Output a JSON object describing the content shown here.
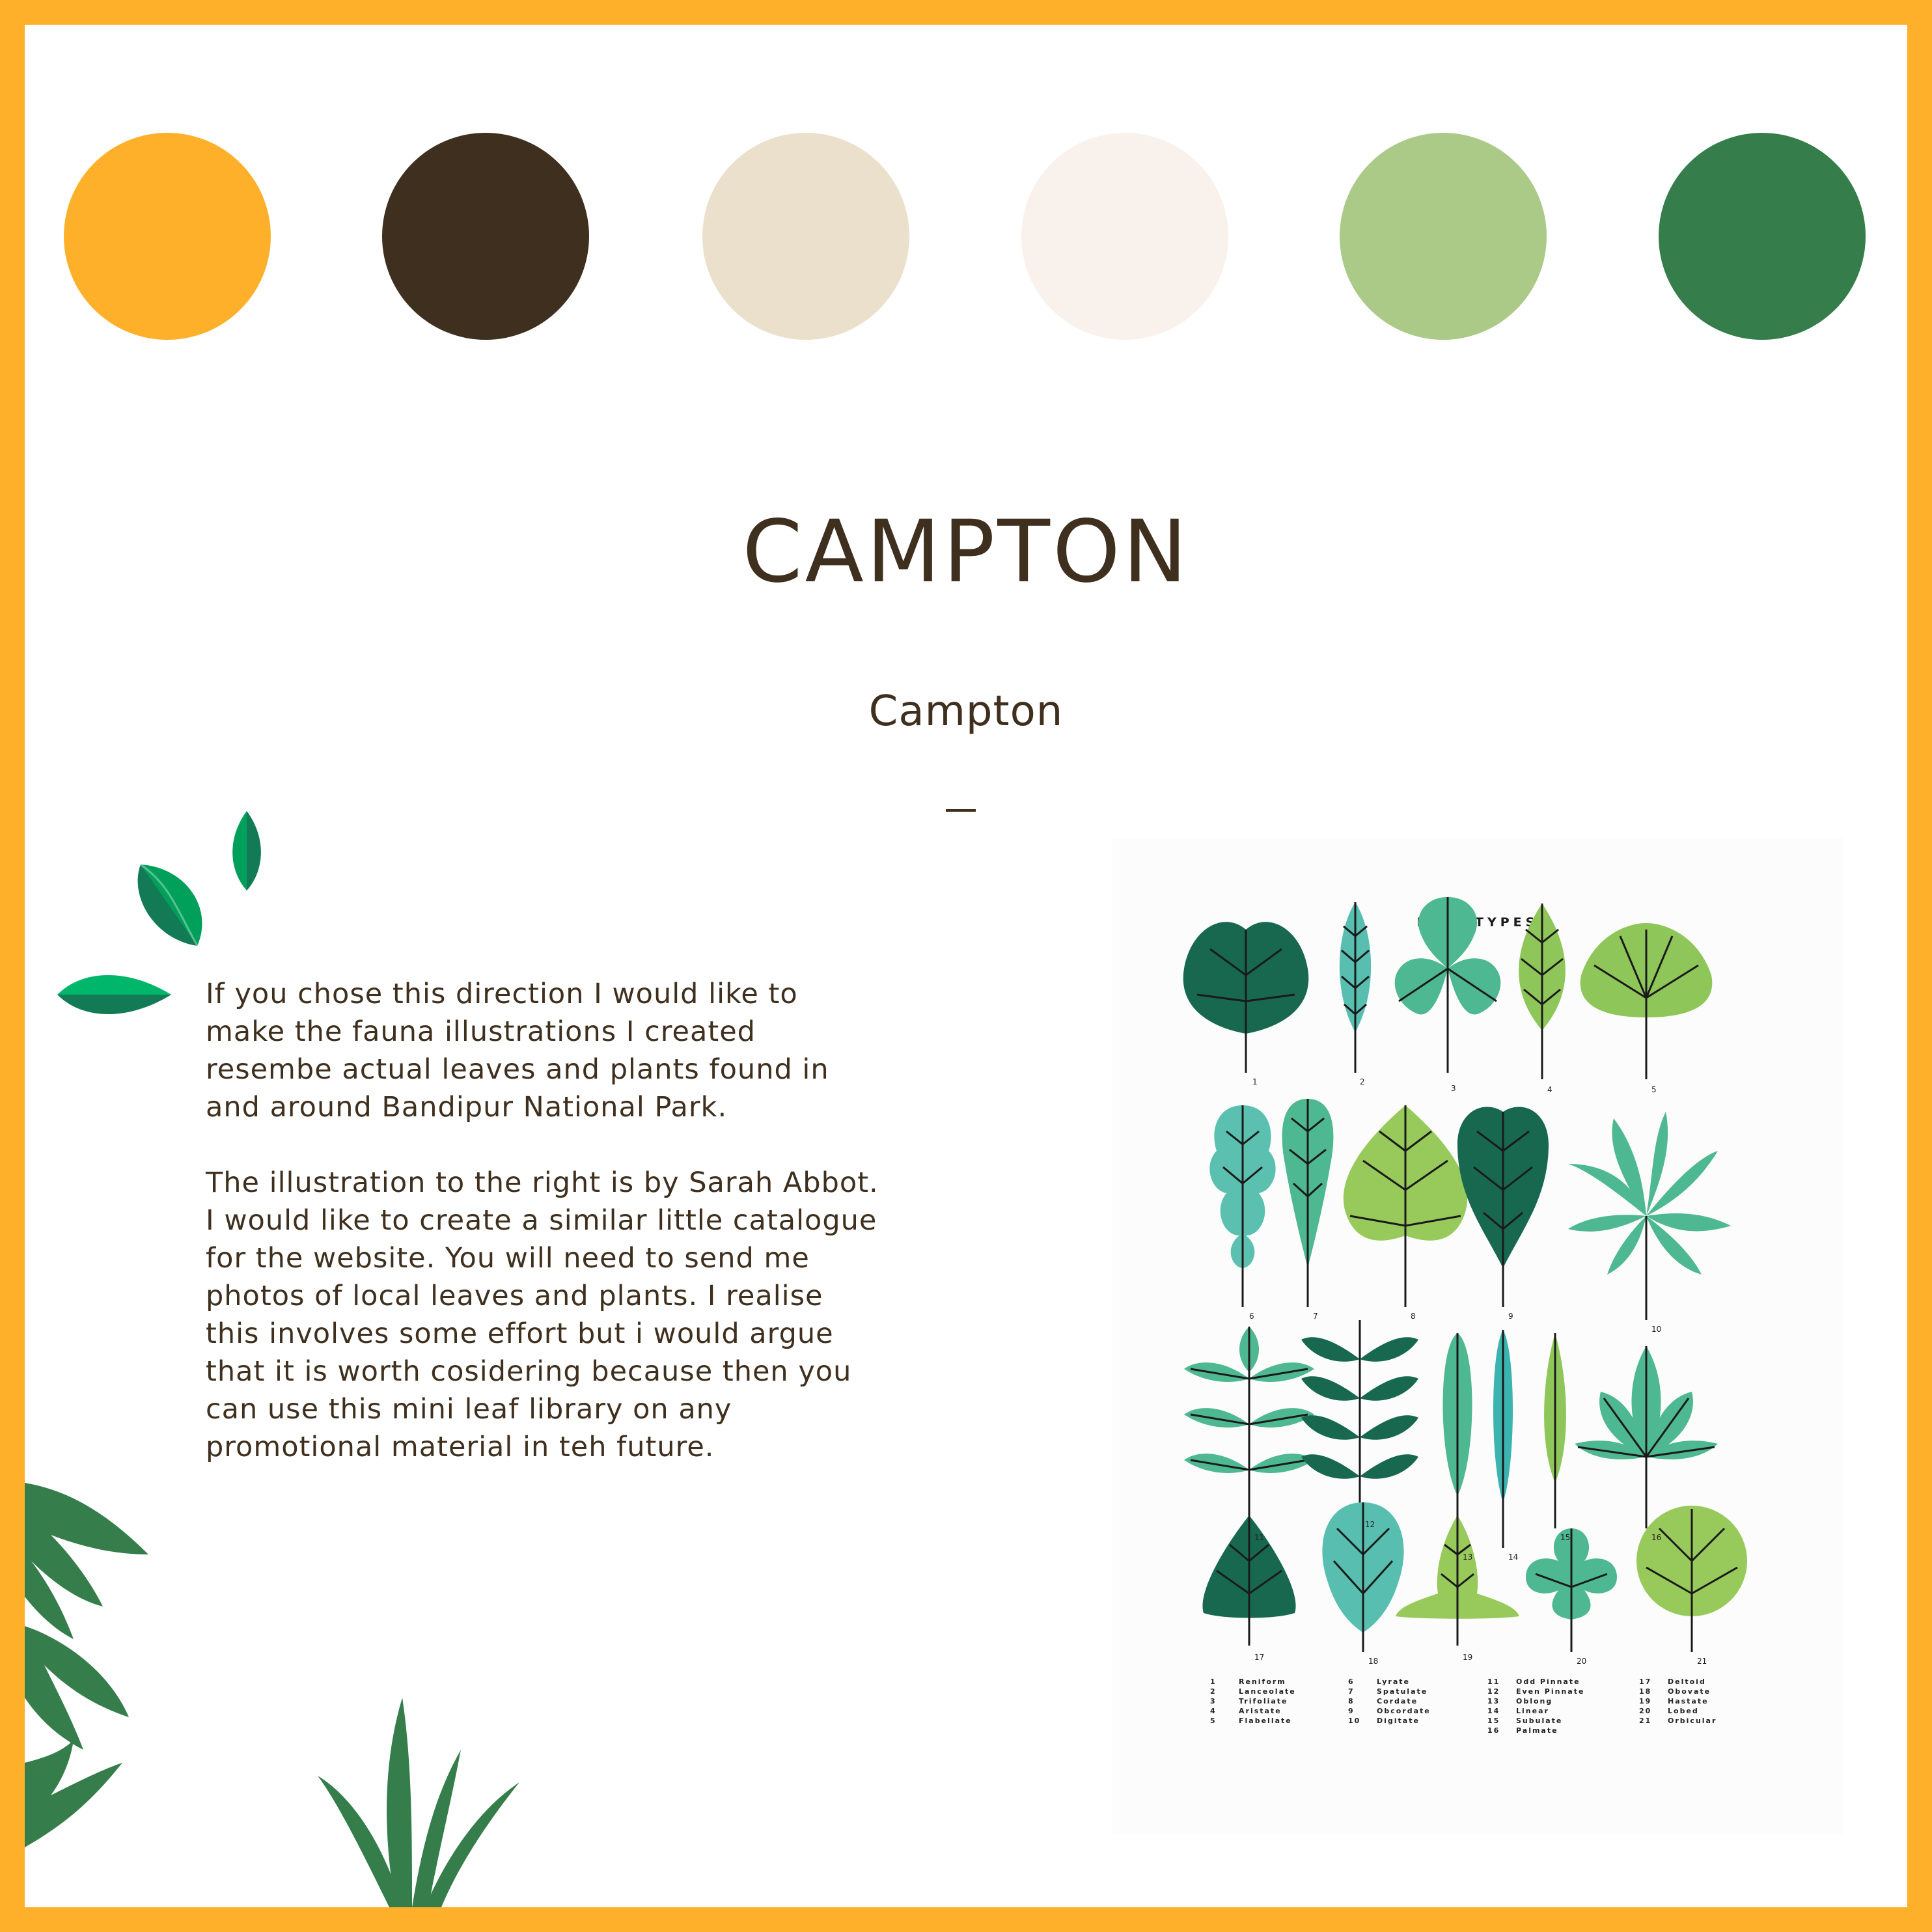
{
  "palette": [
    {
      "name": "orange",
      "hex": "#FFB02B"
    },
    {
      "name": "dark-brown",
      "hex": "#3F2F1E"
    },
    {
      "name": "beige",
      "hex": "#EAE0CC"
    },
    {
      "name": "off-white",
      "hex": "#F9F1EC"
    },
    {
      "name": "light-green",
      "hex": "#ABCA88"
    },
    {
      "name": "dark-green",
      "hex": "#357E4B"
    }
  ],
  "heading": {
    "title": "CAMPTON",
    "subtitle": "Campton"
  },
  "body": {
    "paragraph_1": "If you chose this direction I would like to\nmake the fauna illustrations I created\nresembe actual leaves and plants found in\nand around Bandipur National Park.",
    "paragraph_2": "The illustration to the right is by Sarah Abbot.\nI would like to create a similar little catalogue\nfor the website. You will need to send me\nphotos of local leaves and plants. I realise\nthis involves some effort but i would argue\nthat it is worth cosidering because then you\ncan use this mini leaf library on any\npromotional material in teh future."
  },
  "poster": {
    "title": "LEAF TYPES",
    "leaf_numbers": [
      "1",
      "2",
      "3",
      "4",
      "5",
      "6",
      "7",
      "8",
      "9",
      "10",
      "11",
      "12",
      "13",
      "14",
      "15",
      "16",
      "17",
      "18",
      "19",
      "20",
      "21"
    ],
    "legend_columns": [
      [
        {
          "n": "1",
          "name": "Reniform"
        },
        {
          "n": "2",
          "name": "Lanceolate"
        },
        {
          "n": "3",
          "name": "Trifoliate"
        },
        {
          "n": "4",
          "name": "Aristate"
        },
        {
          "n": "5",
          "name": "Flabellate"
        }
      ],
      [
        {
          "n": "6",
          "name": "Lyrate"
        },
        {
          "n": "7",
          "name": "Spatulate"
        },
        {
          "n": "8",
          "name": "Cordate"
        },
        {
          "n": "9",
          "name": "Obcordate"
        },
        {
          "n": "10",
          "name": "Digitate"
        }
      ],
      [
        {
          "n": "11",
          "name": "Odd Pinnate"
        },
        {
          "n": "12",
          "name": "Even Pinnate"
        },
        {
          "n": "13",
          "name": "Oblong"
        },
        {
          "n": "14",
          "name": "Linear"
        },
        {
          "n": "15",
          "name": "Subulate"
        },
        {
          "n": "16",
          "name": "Palmate"
        }
      ],
      [
        {
          "n": "17",
          "name": "Deltoid"
        },
        {
          "n": "18",
          "name": "Obovate"
        },
        {
          "n": "19",
          "name": "Hastate"
        },
        {
          "n": "20",
          "name": "Lobed"
        },
        {
          "n": "21",
          "name": "Orbicular"
        }
      ]
    ]
  }
}
